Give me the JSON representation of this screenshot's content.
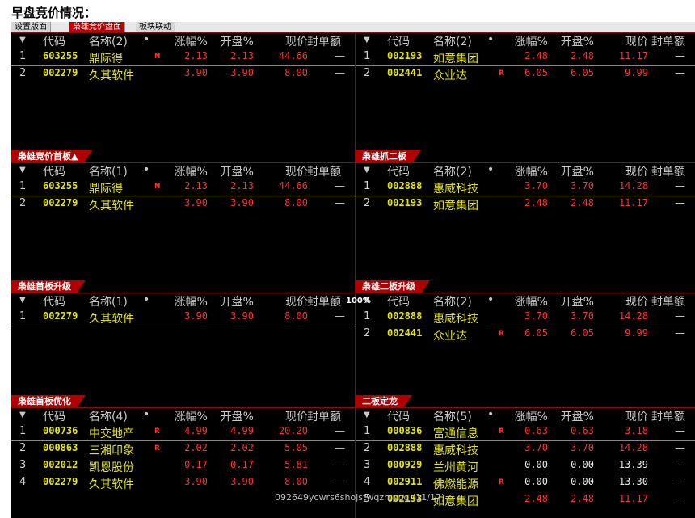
{
  "heading": "早盘竞价情况：",
  "tabs": [
    "设置版面",
    "枭雄竞价盘面",
    "板块联动"
  ],
  "zoom": "100%",
  "watermark": "092649ycwrs6shojstwqzh.png (11/17)",
  "columns": {
    "code": "代码",
    "chg": "涨幅%",
    "open": "开盘%",
    "price": "现价",
    "seal": "封单额",
    "dot": "•",
    "arrow": "▼"
  },
  "panels": [
    {
      "title": "",
      "name_header": "名称(2)",
      "rows": [
        {
          "idx": "1",
          "code": "603255",
          "name": "鼎际得",
          "mark": "N",
          "chg": "2.13",
          "open": "2.13",
          "price": "44.66",
          "seal": "—",
          "color": "red"
        },
        {
          "idx": "2",
          "code": "002279",
          "name": "久其软件",
          "mark": "",
          "chg": "3.90",
          "open": "3.90",
          "price": "8.00",
          "seal": "—",
          "color": "red"
        }
      ]
    },
    {
      "title": "",
      "name_header": "名称(2)",
      "rows": [
        {
          "idx": "1",
          "code": "002193",
          "name": "如意集团",
          "mark": "",
          "chg": "2.48",
          "open": "2.48",
          "price": "11.17",
          "seal": "—",
          "color": "red"
        },
        {
          "idx": "2",
          "code": "002441",
          "name": "众业达",
          "mark": "R",
          "chg": "6.05",
          "open": "6.05",
          "price": "9.99",
          "seal": "—",
          "color": "red"
        }
      ]
    },
    {
      "title": "枭雄竞价首板▲",
      "name_header": "名称(1)",
      "rows": [
        {
          "idx": "1",
          "code": "603255",
          "name": "鼎际得",
          "mark": "N",
          "chg": "2.13",
          "open": "2.13",
          "price": "44.66",
          "seal": "—",
          "color": "red"
        },
        {
          "idx": "2",
          "code": "002279",
          "name": "久其软件",
          "mark": "",
          "chg": "3.90",
          "open": "3.90",
          "price": "8.00",
          "seal": "—",
          "color": "red"
        }
      ]
    },
    {
      "title": "枭雄抓二板",
      "name_header": "名称(2)",
      "rows": [
        {
          "idx": "1",
          "code": "002888",
          "name": "惠威科技",
          "mark": "",
          "chg": "3.70",
          "open": "3.70",
          "price": "14.28",
          "seal": "—",
          "color": "red"
        },
        {
          "idx": "2",
          "code": "002193",
          "name": "如意集团",
          "mark": "",
          "chg": "2.48",
          "open": "2.48",
          "price": "11.17",
          "seal": "—",
          "color": "red"
        }
      ]
    },
    {
      "title": "枭雄首板升级",
      "name_header": "名称(1)",
      "rows": [
        {
          "idx": "1",
          "code": "002279",
          "name": "久其软件",
          "mark": "",
          "chg": "3.90",
          "open": "3.90",
          "price": "8.00",
          "seal": "—",
          "color": "red"
        }
      ]
    },
    {
      "title": "枭雄二板升级",
      "name_header": "名称(2)",
      "rows": [
        {
          "idx": "1",
          "code": "002888",
          "name": "惠威科技",
          "mark": "",
          "chg": "3.70",
          "open": "3.70",
          "price": "14.28",
          "seal": "—",
          "color": "red"
        },
        {
          "idx": "2",
          "code": "002441",
          "name": "众业达",
          "mark": "R",
          "chg": "6.05",
          "open": "6.05",
          "price": "9.99",
          "seal": "—",
          "color": "red"
        }
      ]
    },
    {
      "title": "枭雄首板优化",
      "name_header": "名称(4)",
      "rows": [
        {
          "idx": "1",
          "code": "000736",
          "name": "中交地产",
          "mark": "R",
          "chg": "4.99",
          "open": "4.99",
          "price": "20.20",
          "seal": "—",
          "color": "red"
        },
        {
          "idx": "2",
          "code": "000863",
          "name": "三湘印象",
          "mark": "R",
          "chg": "2.02",
          "open": "2.02",
          "price": "5.05",
          "seal": "—",
          "color": "red"
        },
        {
          "idx": "3",
          "code": "002012",
          "name": "凯恩股份",
          "mark": "",
          "chg": "0.17",
          "open": "0.17",
          "price": "5.81",
          "seal": "—",
          "color": "red"
        },
        {
          "idx": "4",
          "code": "002279",
          "name": "久其软件",
          "mark": "",
          "chg": "3.90",
          "open": "3.90",
          "price": "8.00",
          "seal": "—",
          "color": "red"
        }
      ]
    },
    {
      "title": "二板定龙",
      "name_header": "名称(5)",
      "rows": [
        {
          "idx": "1",
          "code": "000836",
          "name": "富通信息",
          "mark": "R",
          "chg": "0.63",
          "open": "0.63",
          "price": "3.18",
          "seal": "—",
          "color": "red"
        },
        {
          "idx": "2",
          "code": "002888",
          "name": "惠威科技",
          "mark": "",
          "chg": "3.70",
          "open": "3.70",
          "price": "14.28",
          "seal": "—",
          "color": "red"
        },
        {
          "idx": "3",
          "code": "000929",
          "name": "兰州黄河",
          "mark": "",
          "chg": "0.00",
          "open": "0.00",
          "price": "13.39",
          "seal": "—",
          "color": "white"
        },
        {
          "idx": "4",
          "code": "002911",
          "name": "佛燃能源",
          "mark": "R",
          "chg": "0.00",
          "open": "0.00",
          "price": "13.30",
          "seal": "—",
          "color": "white"
        },
        {
          "idx": "5",
          "code": "002193",
          "name": "如意集团",
          "mark": "",
          "chg": "2.48",
          "open": "2.48",
          "price": "11.17",
          "seal": "—",
          "color": "red"
        }
      ]
    }
  ]
}
